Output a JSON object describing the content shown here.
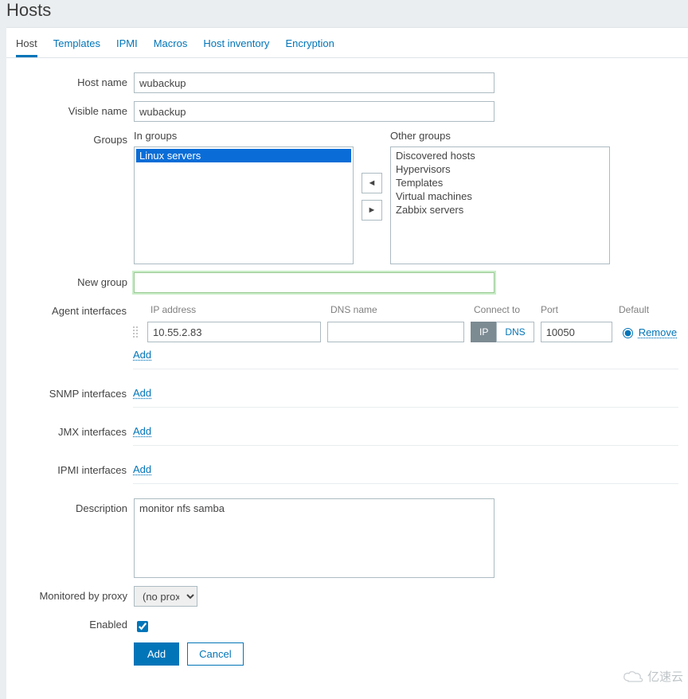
{
  "page": {
    "title": "Hosts"
  },
  "tabs": [
    {
      "label": "Host",
      "active": true
    },
    {
      "label": "Templates"
    },
    {
      "label": "IPMI"
    },
    {
      "label": "Macros"
    },
    {
      "label": "Host inventory"
    },
    {
      "label": "Encryption"
    }
  ],
  "labels": {
    "host_name": "Host name",
    "visible_name": "Visible name",
    "groups": "Groups",
    "in_groups": "In groups",
    "other_groups": "Other groups",
    "new_group": "New group",
    "agent_interfaces": "Agent interfaces",
    "snmp_interfaces": "SNMP interfaces",
    "jmx_interfaces": "JMX interfaces",
    "ipmi_interfaces": "IPMI interfaces",
    "description": "Description",
    "monitored_by_proxy": "Monitored by proxy",
    "enabled": "Enabled",
    "ip_address": "IP address",
    "dns_name": "DNS name",
    "connect_to": "Connect to",
    "port": "Port",
    "default": "Default"
  },
  "host_form": {
    "host_name": "wubackup",
    "visible_name": "wubackup",
    "new_group": "",
    "description": "monitor nfs samba",
    "enabled": true,
    "proxy_selected": "(no proxy)"
  },
  "in_groups": [
    {
      "label": "Linux servers",
      "selected": true
    }
  ],
  "other_groups": [
    {
      "label": "Discovered hosts"
    },
    {
      "label": "Hypervisors"
    },
    {
      "label": "Templates"
    },
    {
      "label": "Virtual machines"
    },
    {
      "label": "Zabbix servers"
    }
  ],
  "agent_interface": {
    "ip": "10.55.2.83",
    "dns": "",
    "connect_to_ip": "IP",
    "connect_to_dns": "DNS",
    "connect_active": "IP",
    "port": "10050",
    "default": true
  },
  "links": {
    "add": "Add",
    "remove": "Remove"
  },
  "buttons": {
    "add": "Add",
    "cancel": "Cancel"
  },
  "watermark": "亿速云"
}
